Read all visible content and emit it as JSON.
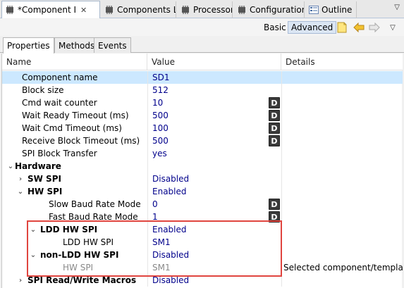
{
  "tabs": [
    {
      "label": "*Component I",
      "icon": "component-icon",
      "active": true,
      "closable": true
    },
    {
      "label": "Components L",
      "icon": "components-library-icon"
    },
    {
      "label": "Processor",
      "icon": "processor-icon"
    },
    {
      "label": "Configuration",
      "icon": "configuration-icon"
    },
    {
      "label": "Outline",
      "icon": "outline-icon"
    }
  ],
  "toolbar": {
    "basic_label": "Basic",
    "advanced_label": "Advanced"
  },
  "subtabs": [
    "Properties",
    "Methods",
    "Events"
  ],
  "columns": {
    "name": "Name",
    "value": "Value",
    "details": "Details"
  },
  "rows": [
    {
      "name": "Component name",
      "value": "SD1",
      "details": ""
    },
    {
      "name": "Block size",
      "value": "512",
      "details": ""
    },
    {
      "name": "Cmd wait counter",
      "value": "10",
      "details": "",
      "dbutton": "D"
    },
    {
      "name": "Wait Ready Timeout (ms)",
      "value": "500",
      "details": "",
      "dbutton": "D"
    },
    {
      "name": "Wait Cmd Timeout (ms)",
      "value": "100",
      "details": "",
      "dbutton": "D"
    },
    {
      "name": "Receive Block Timeout (ms)",
      "value": "500",
      "details": "",
      "dbutton": "D"
    },
    {
      "name": "SPI Block Transfer",
      "value": "yes",
      "details": ""
    },
    {
      "name": "Hardware",
      "value": "",
      "details": ""
    },
    {
      "name": "SW SPI",
      "value": "Disabled",
      "details": ""
    },
    {
      "name": "HW SPI",
      "value": "Enabled",
      "details": ""
    },
    {
      "name": "Slow Baud Rate Mode",
      "value": "0",
      "details": "",
      "dbutton": "D"
    },
    {
      "name": "Fast Baud Rate Mode",
      "value": "1",
      "details": "",
      "dbutton": "D"
    },
    {
      "name": "LDD HW SPI",
      "value": "Enabled",
      "details": ""
    },
    {
      "name": "LDD HW SPI",
      "value": "SM1",
      "details": ""
    },
    {
      "name": "non-LDD HW SPI",
      "value": "Disabled",
      "details": ""
    },
    {
      "name": "HW SPI",
      "value": "SM1",
      "details": "Selected component/template"
    },
    {
      "name": "SPI Read/Write Macros",
      "value": "Disabled",
      "details": ""
    }
  ]
}
